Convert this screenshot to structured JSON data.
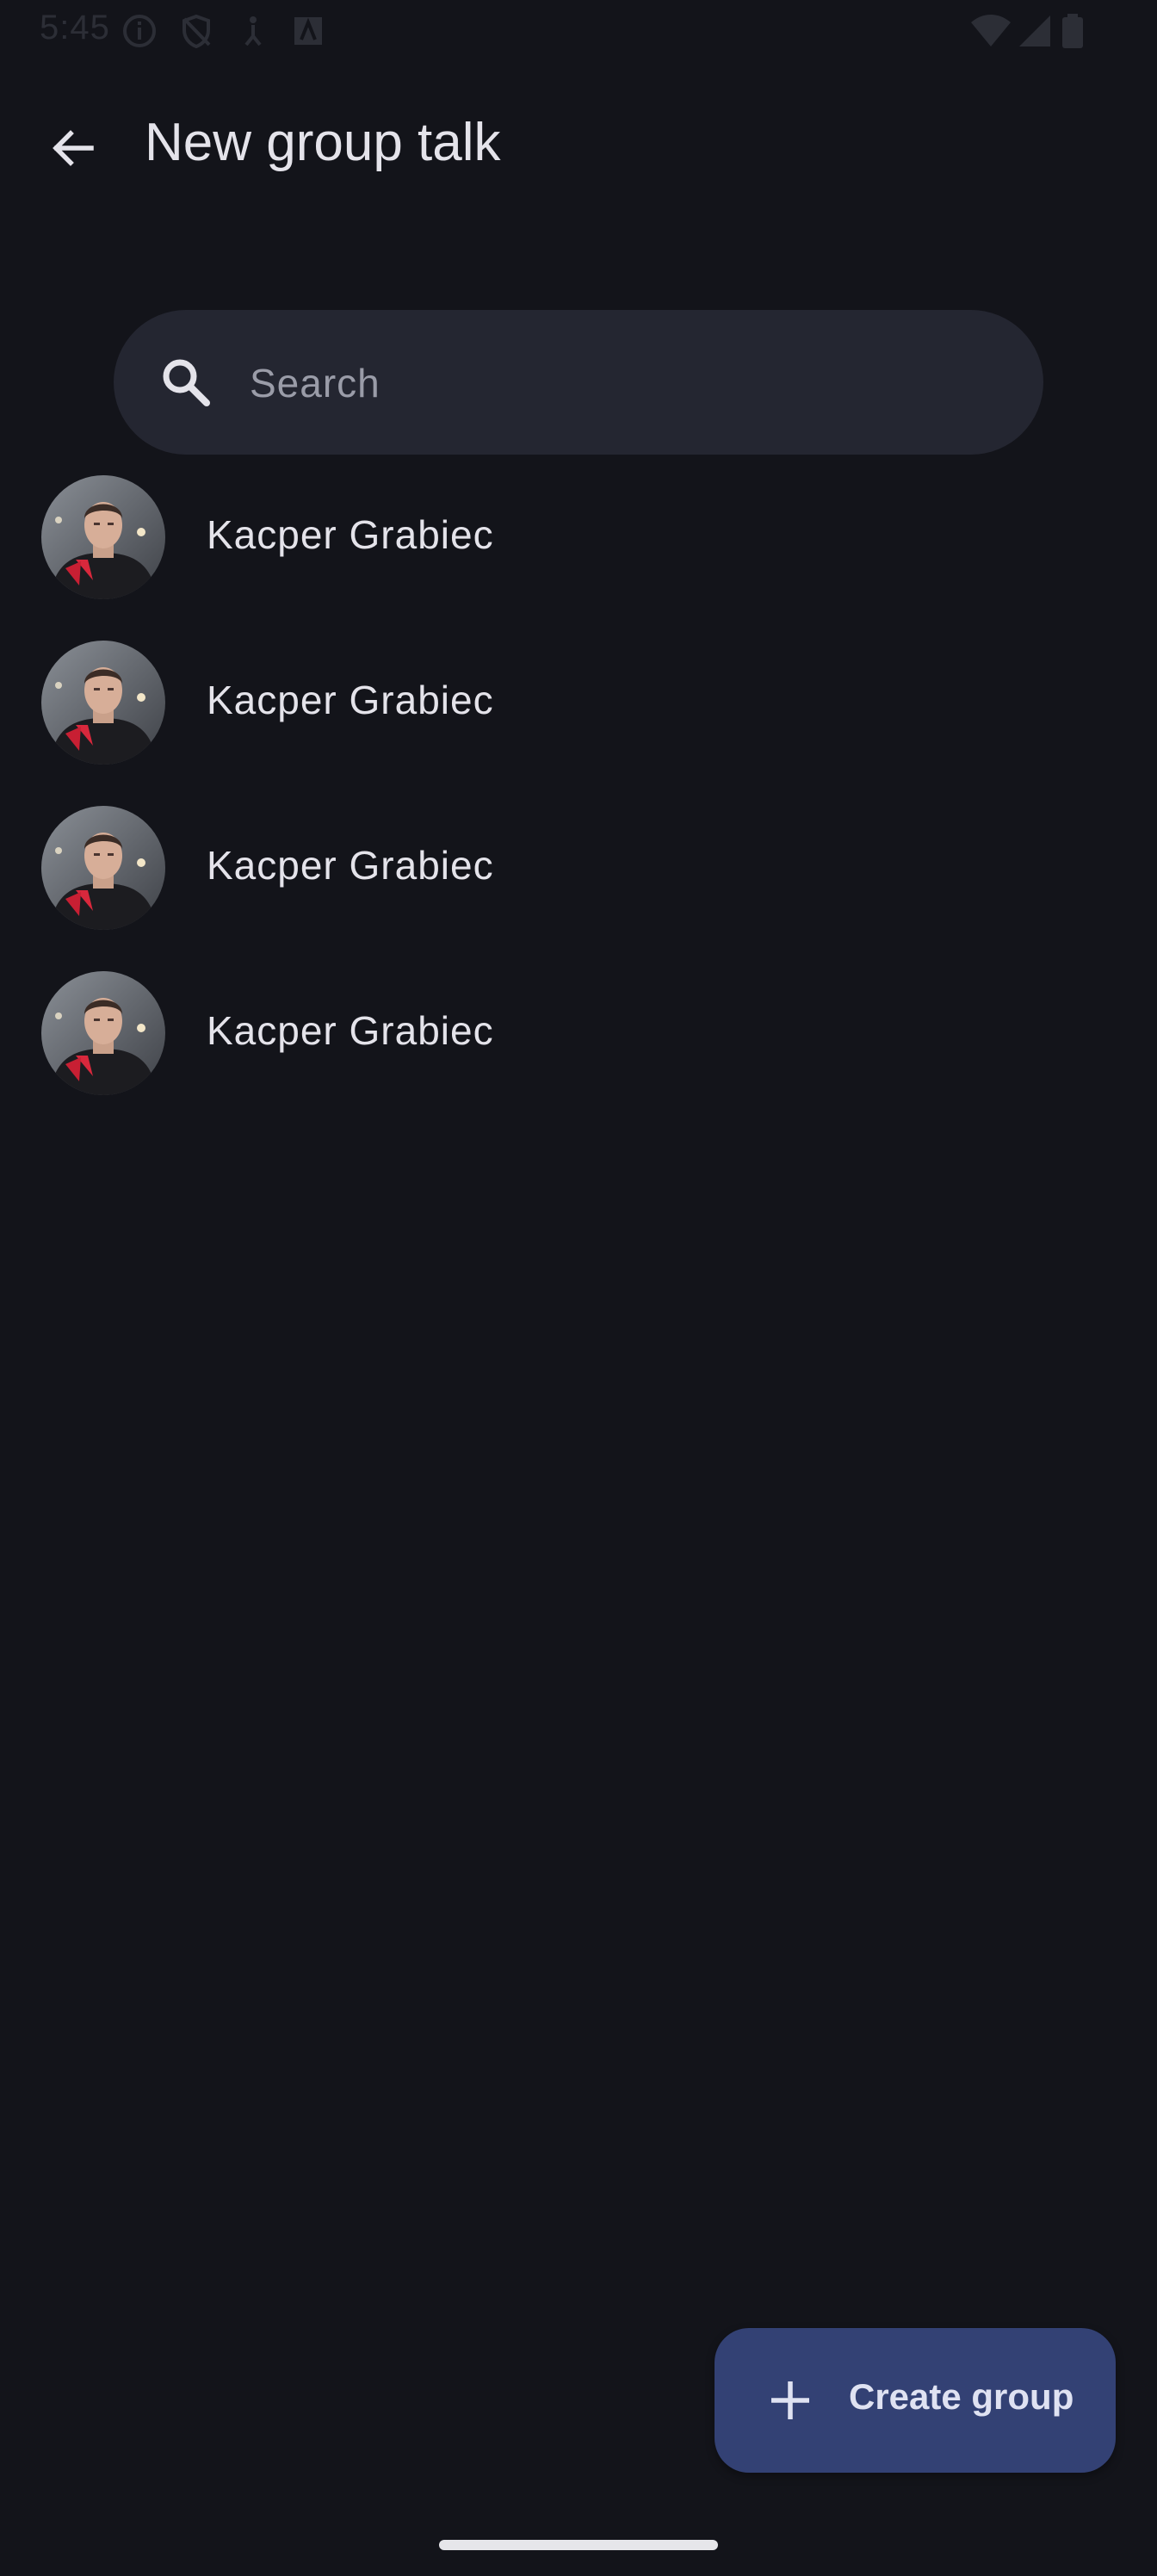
{
  "status_bar": {
    "time": "5:45"
  },
  "app_bar": {
    "title": "New group talk",
    "back_icon": "arrow-back-icon"
  },
  "search": {
    "placeholder": "Search",
    "icon": "search-icon"
  },
  "contacts": [
    {
      "name": "Kacper Grabiec",
      "avatar": "profile-photo"
    },
    {
      "name": "Kacper Grabiec",
      "avatar": "profile-photo"
    },
    {
      "name": "Kacper Grabiec",
      "avatar": "profile-photo"
    },
    {
      "name": "Kacper Grabiec",
      "avatar": "profile-photo"
    }
  ],
  "fab": {
    "label": "Create group",
    "icon": "plus-icon"
  },
  "colors": {
    "background": "#13141a",
    "search_background": "#242631",
    "fab_background": "#334174",
    "text_primary": "#e4e3ea",
    "text_hint": "#9a9ca8"
  }
}
